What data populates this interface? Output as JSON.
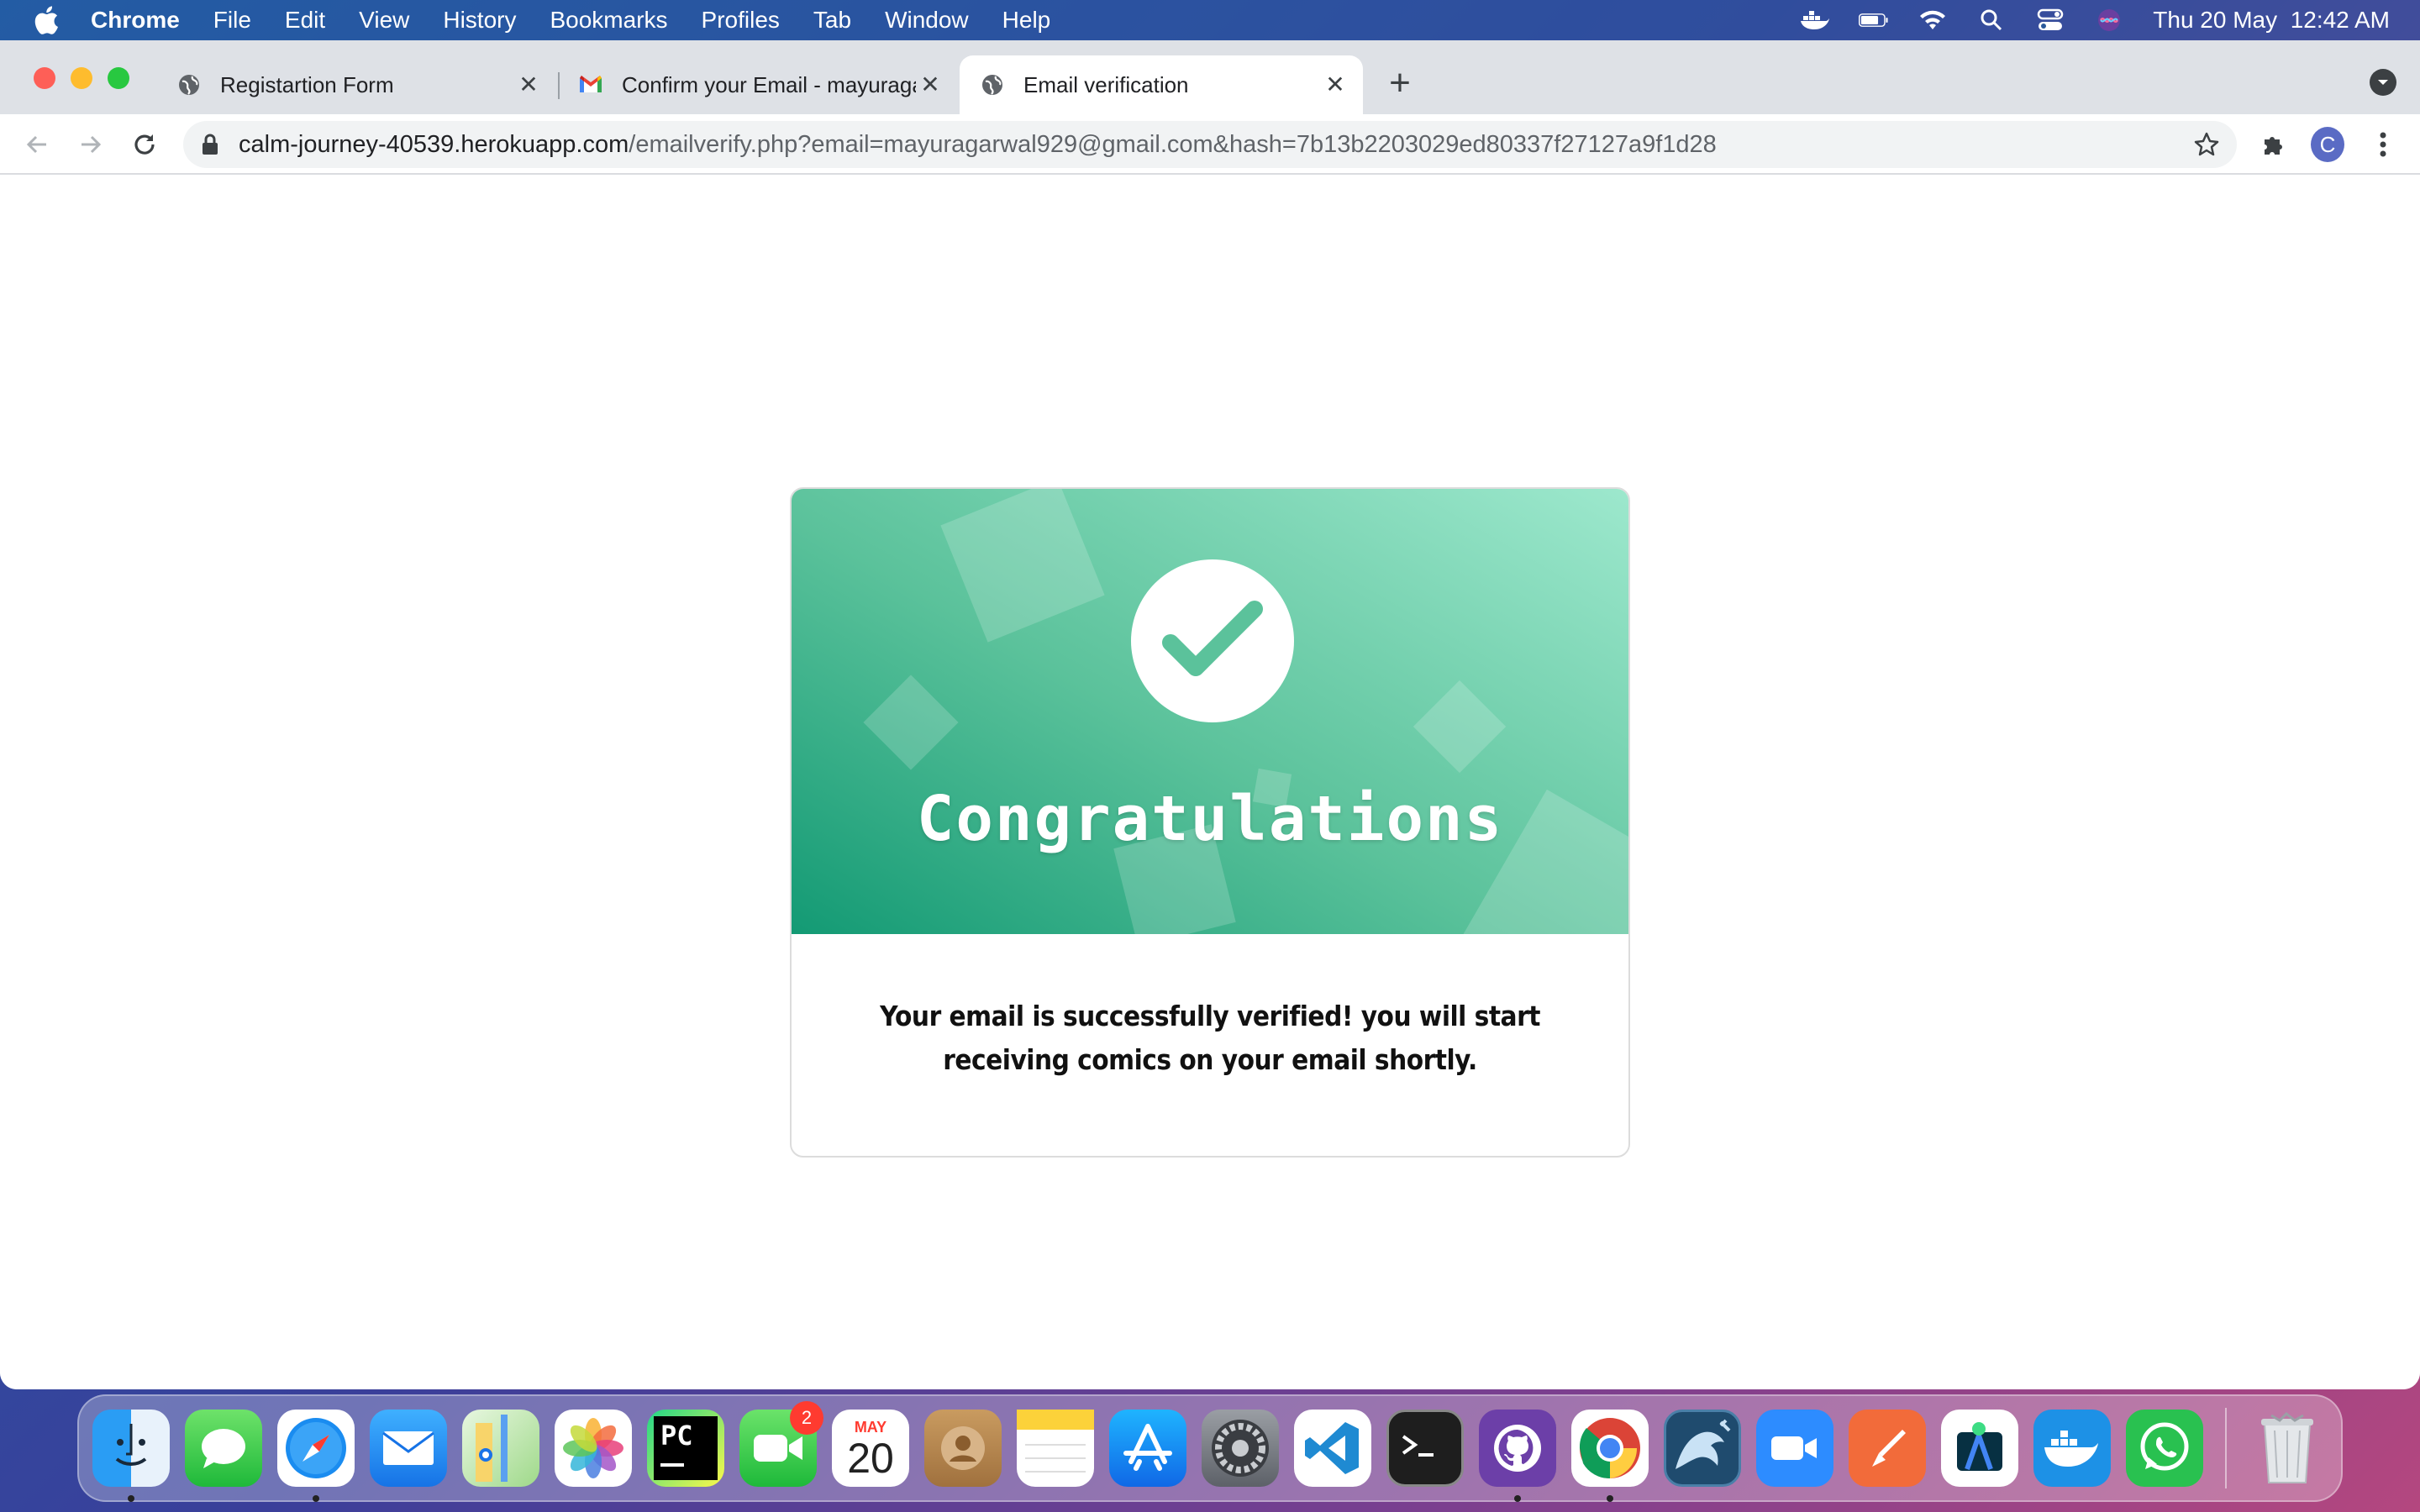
{
  "menubar": {
    "app_name": "Chrome",
    "items": [
      "File",
      "Edit",
      "View",
      "History",
      "Bookmarks",
      "Profiles",
      "Tab",
      "Window",
      "Help"
    ],
    "datetime": "Thu 20 May  12:42 AM"
  },
  "tabs": [
    {
      "title": "Registartion Form",
      "icon": "globe-icon",
      "active": false
    },
    {
      "title": "Confirm your Email - mayuraga",
      "icon": "gmail-icon",
      "active": false
    },
    {
      "title": "Email verification",
      "icon": "globe-icon",
      "active": true
    }
  ],
  "omnibox": {
    "host": "calm-journey-40539.herokuapp.com",
    "path": "/emailverify.php?email=mayuragarwal929@gmail.com&hash=7b13b2203029ed80337f27127a9f1d28"
  },
  "profile": {
    "initial": "C"
  },
  "card": {
    "heading": "Congratulations",
    "message": "Your email is successfully verified! you will start receiving comics on your email shortly."
  },
  "dock": {
    "calendar_month": "MAY",
    "calendar_day": "20",
    "facetime_badge": "2",
    "pycharm_label": "PC"
  },
  "colors": {
    "card_gradient_start": "#139a74",
    "card_gradient_end": "#9de8cd",
    "check_color": "#5bc29b"
  }
}
